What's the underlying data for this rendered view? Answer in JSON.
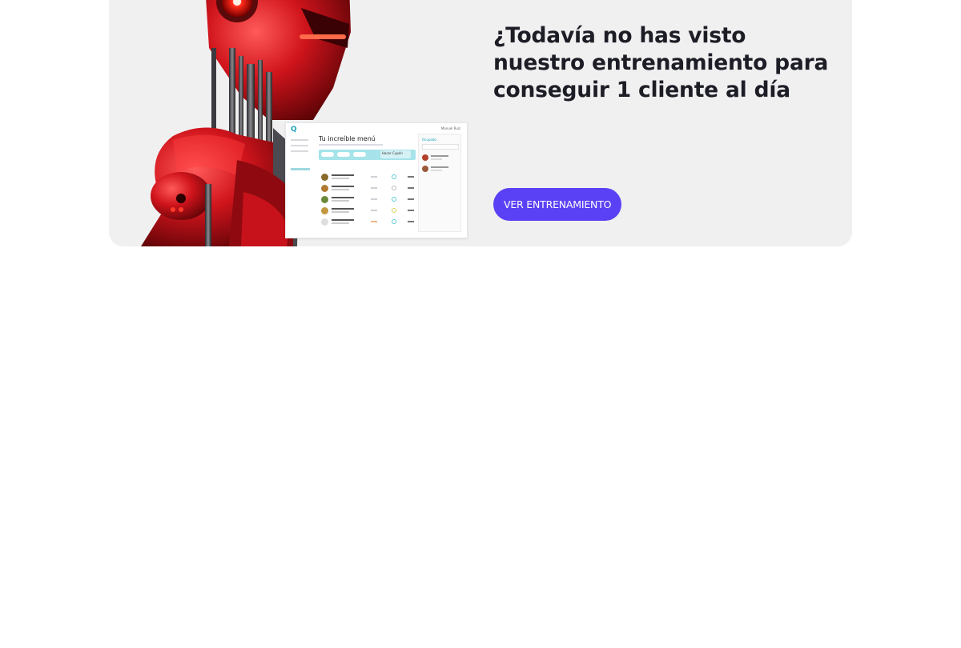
{
  "promo": {
    "headline": "¿Todavía no has visto nuestro entrenamiento para conseguir 1 cliente al día",
    "cta_label": "VER ENTRENAMIENTO"
  },
  "mockup": {
    "logo": "Q",
    "title": "Tu increíble menú",
    "promo_label": "Hacer Cupón",
    "panel_heading": "Ocupado",
    "user_label": "Manuel Ruiz"
  },
  "colors": {
    "banner_bg": "#f0f0f1",
    "headline": "#1d1d26",
    "cta_bg": "#5a41f5",
    "robot_red": "#c8121b"
  },
  "icons": {
    "robot": "robot-illustration"
  }
}
